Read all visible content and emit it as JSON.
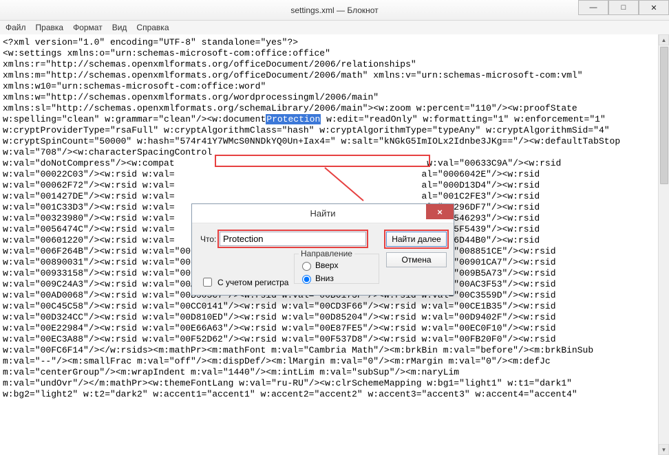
{
  "window": {
    "title": "settings.xml — Блокнот"
  },
  "menu": {
    "file": "Файл",
    "edit": "Правка",
    "format": "Формат",
    "view": "Вид",
    "help": "Справка"
  },
  "dialog": {
    "title": "Найти",
    "what_label": "Что:",
    "find_value": "Protection",
    "find_next": "Найти далее",
    "cancel": "Отмена",
    "direction_label": "Направление",
    "dir_up": "Вверх",
    "dir_down": "Вниз",
    "match_case": "С учетом регистра"
  },
  "selection_word": "Protection",
  "lines": [
    "<?xml version=\"1.0\" encoding=\"UTF-8\" standalone=\"yes\"?>",
    "<w:settings xmlns:o=\"urn:schemas-microsoft-com:office:office\"",
    "xmlns:r=\"http://schemas.openxmlformats.org/officeDocument/2006/relationships\"",
    "xmlns:m=\"http://schemas.openxmlformats.org/officeDocument/2006/math\" xmlns:v=\"urn:schemas-microsoft-com:vml\"",
    "xmlns:w10=\"urn:schemas-microsoft-com:office:word\"",
    "xmlns:w=\"http://schemas.openxmlformats.org/wordprocessingml/2006/main\"",
    "xmlns:sl=\"http://schemas.openxmlformats.org/schemaLibrary/2006/main\"><w:zoom w:percent=\"110\"/><w:proofState",
    "w:spelling=\"clean\" w:grammar=\"clean\"/><w:documentProtection w:edit=\"readOnly\" w:formatting=\"1\" w:enforcement=\"1\"",
    "w:cryptProviderType=\"rsaFull\" w:cryptAlgorithmClass=\"hash\" w:cryptAlgorithmType=\"typeAny\" w:cryptAlgorithmSid=\"4\"",
    "w:cryptSpinCount=\"50000\" w:hash=\"574r41Y7WMcS0NNDkYQ0Un+Iax4=\" w:salt=\"kNGkG5ImIOLx2Idnbe3JKg==\"/><w:defaultTabStop",
    "w:val=\"708\"/><w:characterSpacingControl",
    "w:val=\"doNotCompress\"/><w:compat                                               w:val=\"00633C9A\"/><w:rsid",
    "w:val=\"00022C03\"/><w:rsid w:val=                                              al=\"0006042E\"/><w:rsid",
    "w:val=\"00062F72\"/><w:rsid w:val=                                              al=\"000D13D4\"/><w:rsid",
    "w:val=\"001427DE\"/><w:rsid w:val=                                              al=\"001C2FE3\"/><w:rsid",
    "w:val=\"001C33D3\"/><w:rsid w:val=                                              al=\"00296DF7\"/><w:rsid",
    "w:val=\"00323980\"/><w:rsid w:val=                                              al=\"00546293\"/><w:rsid",
    "w:val=\"0056474C\"/><w:rsid w:val=                                              al=\"005F5439\"/><w:rsid",
    "w:val=\"00601220\"/><w:rsid w:val=                                              al=\"006D44B0\"/><w:rsid",
    "w:val=\"006F264B\"/><w:rsid w:val=\"007F0650\"/><w:rsid w:val=\"00834824\"/><w:rsid w:val=\"008851CE\"/><w:rsid",
    "w:val=\"00890031\"/><w:rsid w:val=\"00897F79\"/><w:rsid w:val=\"008F11B5\"/><w:rsid w:val=\"00901CA7\"/><w:rsid",
    "w:val=\"00933158\"/><w:rsid w:val=\"0099193B\"/><w:rsid w:val=\"009A5A71\"/><w:rsid w:val=\"009B5A73\"/><w:rsid",
    "w:val=\"009C24A3\"/><w:rsid w:val=\"00AA4663\"/><w:rsid w:val=\"00AB3FB3\"/><w:rsid w:val=\"00AC3F53\"/><w:rsid",
    "w:val=\"00AD0068\"/><w:rsid w:val=\"00B305C7\"/><w:rsid w:val=\"00B6173F\"/><w:rsid w:val=\"00C3559D\"/><w:rsid",
    "w:val=\"00C45C58\"/><w:rsid w:val=\"00CC0141\"/><w:rsid w:val=\"00CD3F66\"/><w:rsid w:val=\"00CE1B35\"/><w:rsid",
    "w:val=\"00D324CC\"/><w:rsid w:val=\"00D810ED\"/><w:rsid w:val=\"00D85204\"/><w:rsid w:val=\"00D9402F\"/><w:rsid",
    "w:val=\"00E22984\"/><w:rsid w:val=\"00E66A63\"/><w:rsid w:val=\"00E87FE5\"/><w:rsid w:val=\"00EC0F10\"/><w:rsid",
    "w:val=\"00EC3A88\"/><w:rsid w:val=\"00F52D62\"/><w:rsid w:val=\"00F537D8\"/><w:rsid w:val=\"00FB20F0\"/><w:rsid",
    "w:val=\"00FC6F14\"/></w:rsids><m:mathPr><m:mathFont m:val=\"Cambria Math\"/><m:brkBin m:val=\"before\"/><m:brkBinSub",
    "m:val=\"--\"/><m:smallFrac m:val=\"off\"/><m:dispDef/><m:lMargin m:val=\"0\"/><m:rMargin m:val=\"0\"/><m:defJc",
    "m:val=\"centerGroup\"/><m:wrapIndent m:val=\"1440\"/><m:intLim m:val=\"subSup\"/><m:naryLim",
    "m:val=\"undOvr\"/></m:mathPr><w:themeFontLang w:val=\"ru-RU\"/><w:clrSchemeMapping w:bg1=\"light1\" w:t1=\"dark1\"",
    "w:bg2=\"light2\" w:t2=\"dark2\" w:accent1=\"accent1\" w:accent2=\"accent2\" w:accent3=\"accent3\" w:accent4=\"accent4\""
  ]
}
